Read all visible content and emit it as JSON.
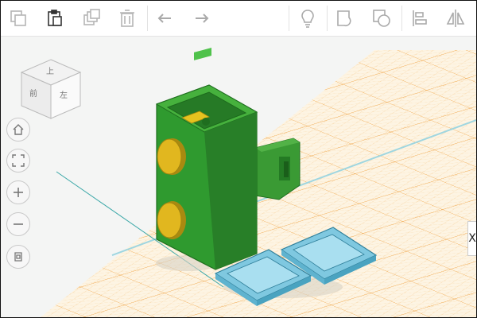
{
  "toolbar": {
    "items": [
      {
        "name": "copy-icon"
      },
      {
        "name": "paste-icon"
      },
      {
        "name": "duplicate-icon"
      },
      {
        "name": "delete-icon"
      },
      {
        "name": "undo-icon"
      },
      {
        "name": "redo-icon"
      },
      {
        "name": "lightbulb-icon"
      },
      {
        "name": "group-icon"
      },
      {
        "name": "ungroup-icon"
      },
      {
        "name": "align-icon"
      },
      {
        "name": "mirror-icon"
      }
    ]
  },
  "viewcube": {
    "label_top": "上",
    "label_front": "前",
    "label_left": "左"
  },
  "nav": {
    "buttons": [
      "home-icon",
      "fit-view-icon",
      "zoom-in-icon",
      "zoom-out-icon",
      "ortho-perspective-icon"
    ]
  },
  "side_tab": {
    "label": "X"
  },
  "colors": {
    "grid_line": "#f2b45a",
    "workplane": "#fdf6e8",
    "green_part": "#2f9a2f",
    "yellow_part": "#e1b71f",
    "blue_part": "#7fc8e0"
  }
}
